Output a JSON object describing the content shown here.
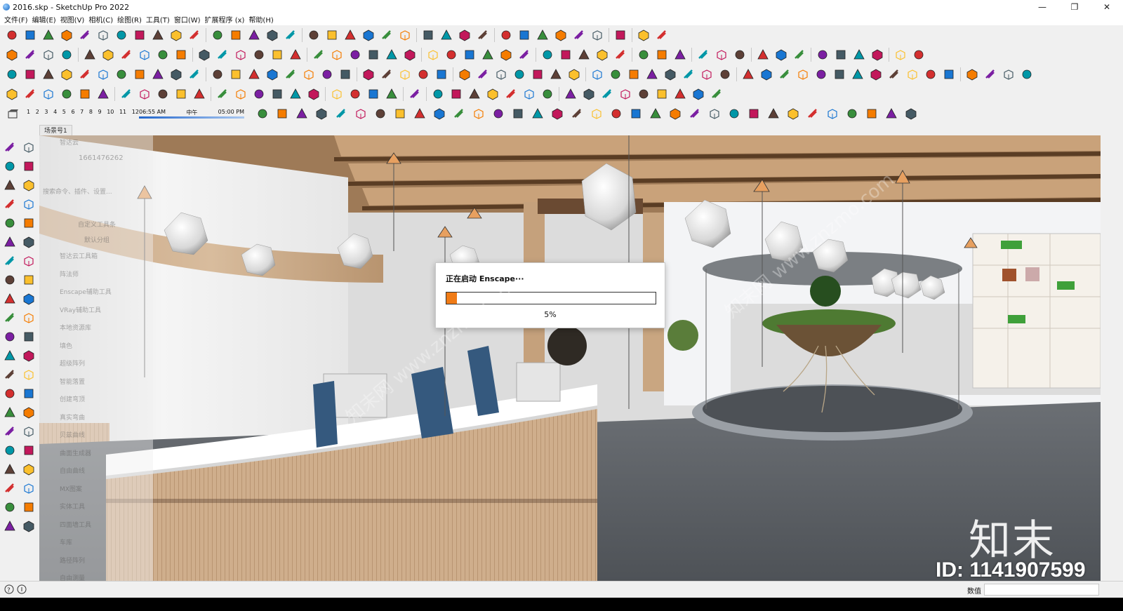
{
  "window": {
    "title": "2016.skp - SketchUp Pro 2022",
    "controls": [
      "—",
      "❐",
      "✕"
    ]
  },
  "menu": [
    "文件(F)",
    "编辑(E)",
    "视图(V)",
    "相机(C)",
    "绘图(R)",
    "工具(T)",
    "窗口(W)",
    "扩展程序 (x)",
    "帮助(H)"
  ],
  "shadow_settings": {
    "months": [
      "1",
      "2",
      "3",
      "4",
      "5",
      "6",
      "7",
      "8",
      "9",
      "10",
      "11",
      "12"
    ],
    "time_start": "06:55 AM",
    "time_mid": "中午",
    "time_end": "05:00 PM"
  },
  "scene": {
    "tab": "场景号1"
  },
  "plugin_panel": {
    "title": "智达云",
    "account": "1661476262",
    "search_placeholder": "搜索命令、插件、设置...",
    "section_custom": "自定义工具条",
    "default_group": "默认分组",
    "items": [
      "智达云工具箱",
      "阵法师",
      "Enscape辅助工具",
      "VRay辅助工具",
      "本地资源库",
      "填色",
      "超级阵列",
      "智能落置",
      "创建弯顶",
      "真实弯曲",
      "贝兹曲线",
      "曲面生成器",
      "自由曲线",
      "MX图案",
      "实体工具",
      "四面墙工具",
      "车库",
      "路径阵列",
      "自由测量"
    ]
  },
  "dialog": {
    "title": "正在启动 Enscape···",
    "progress": 0.05,
    "progress_text": "5%",
    "progress_color": "#f07b16"
  },
  "status": {
    "measurements_label": "数值",
    "measurements_value": ""
  },
  "watermark": {
    "brand": "知末",
    "id": "ID: 1141907599",
    "diag": "知末网 www.znzmo.com"
  }
}
